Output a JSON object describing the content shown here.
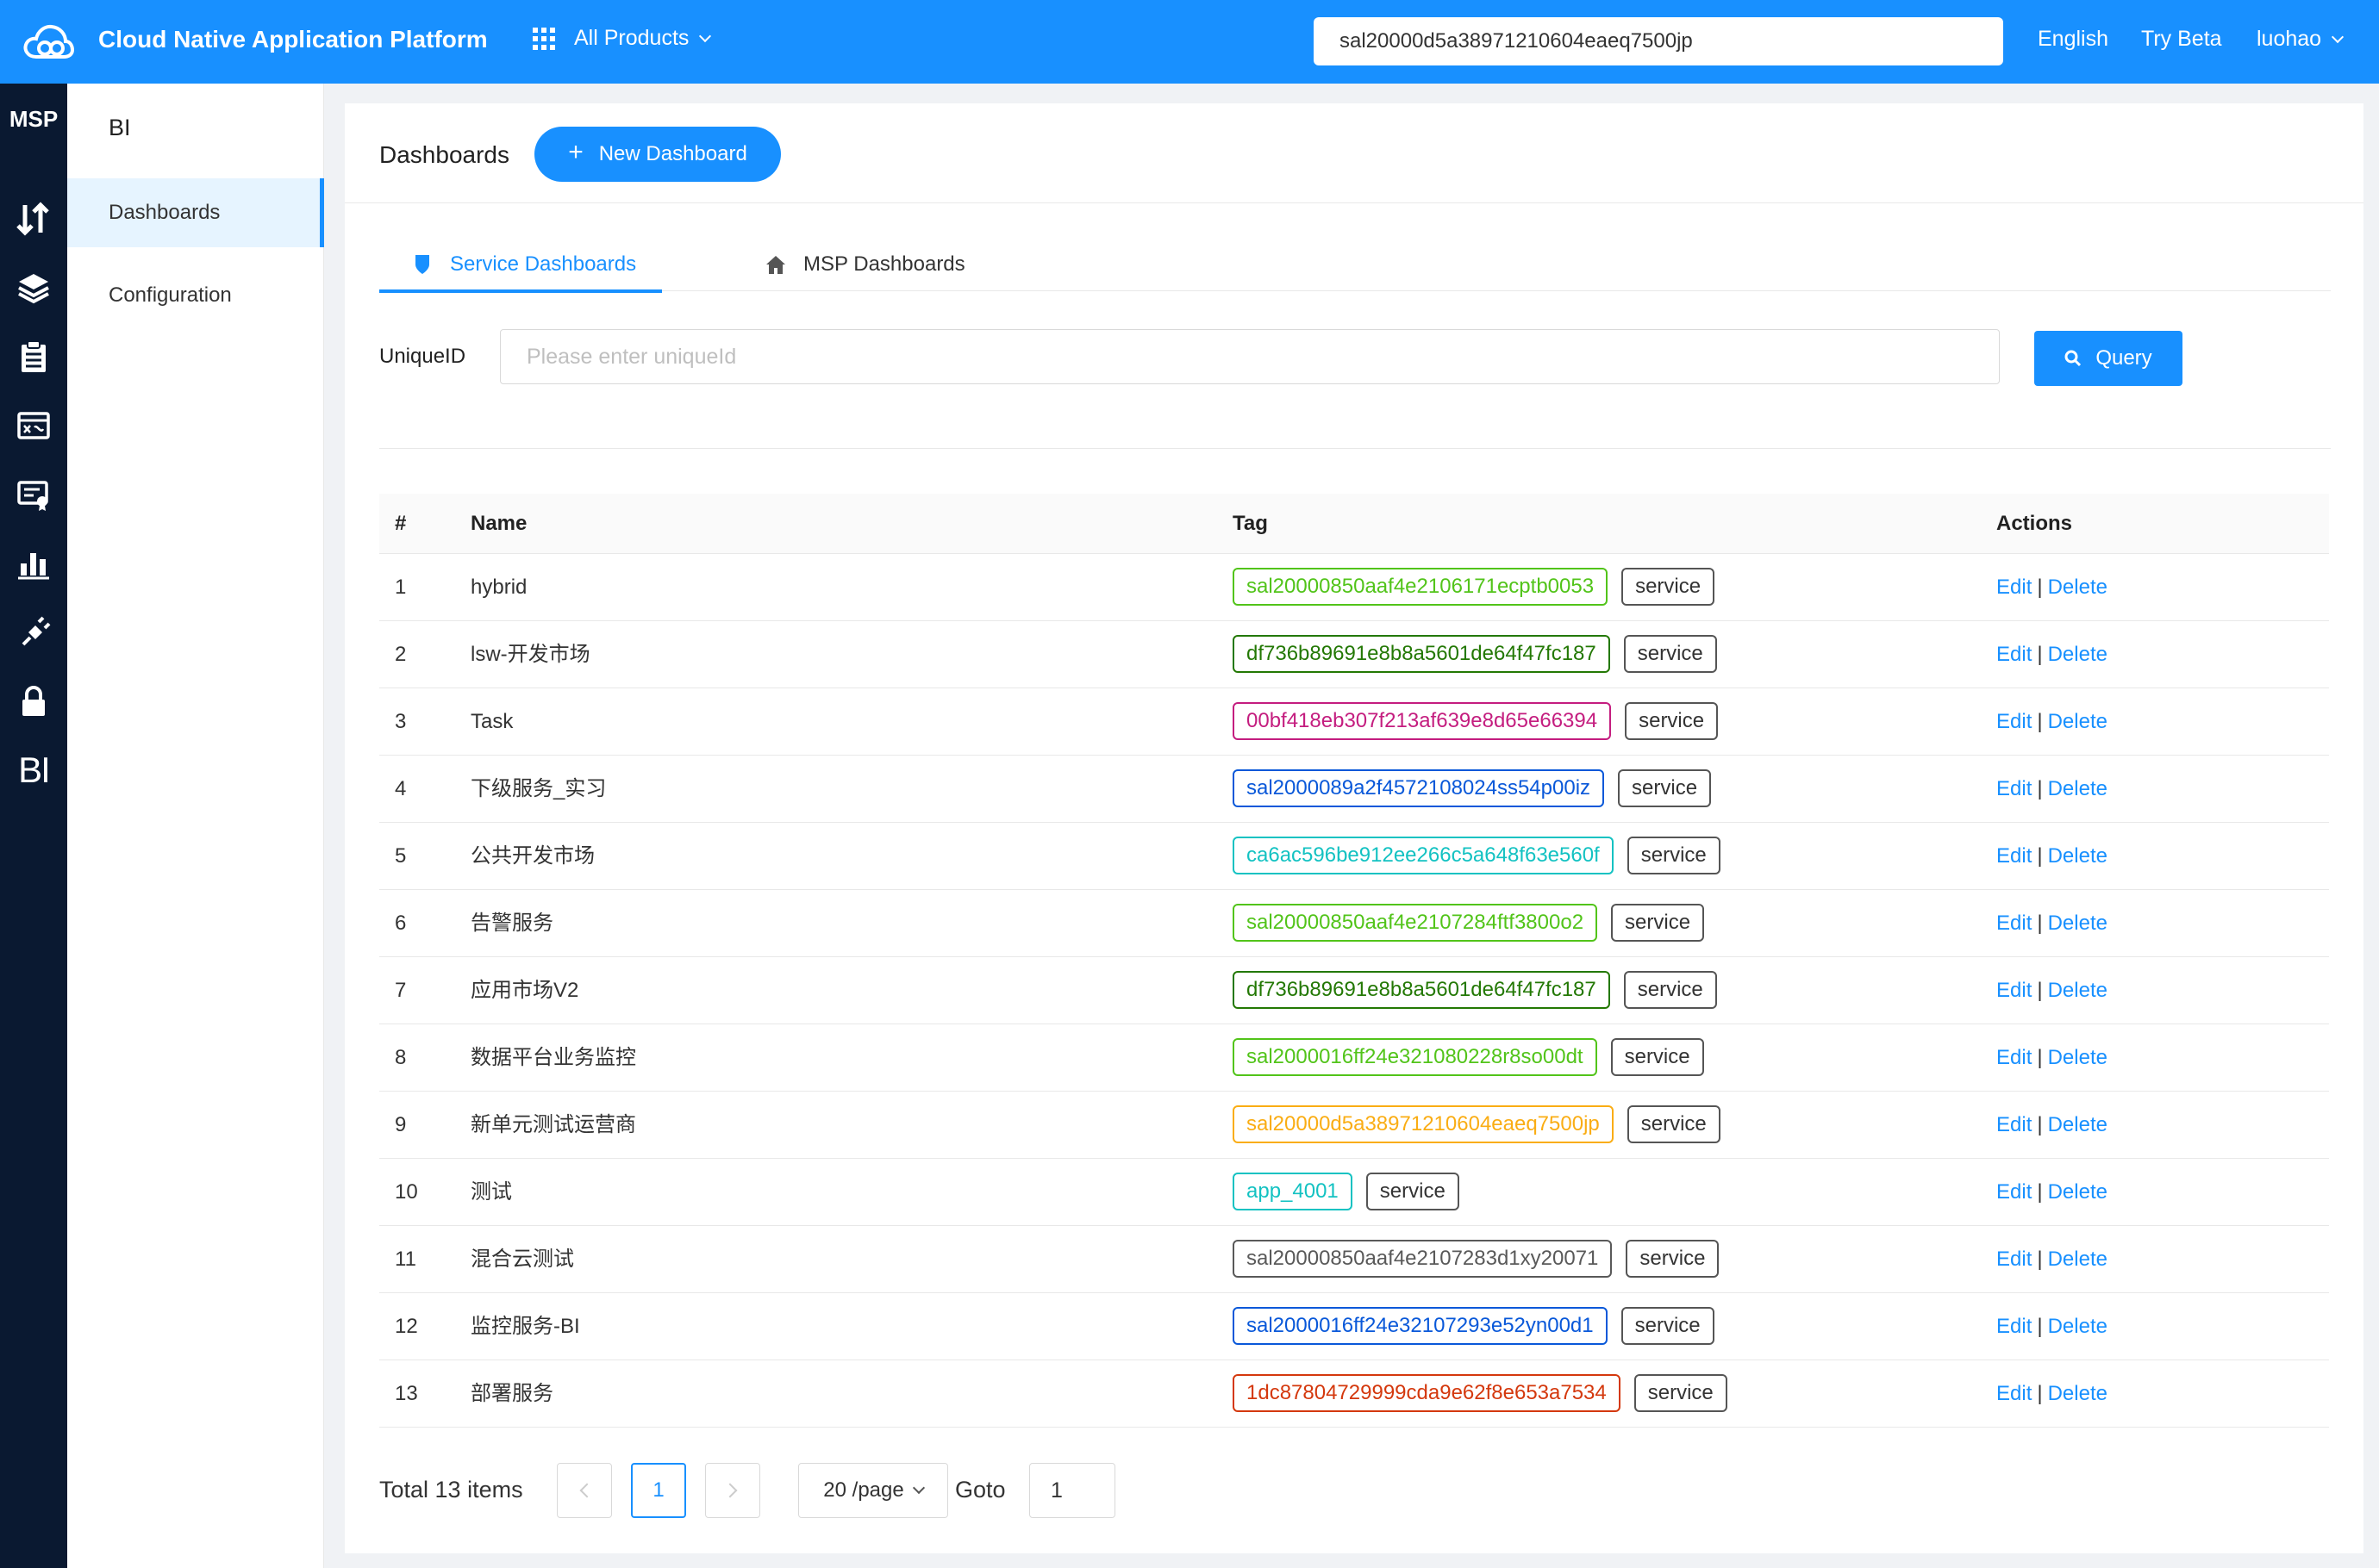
{
  "header": {
    "app_title": "Cloud Native Application Platform",
    "products_label": "All Products",
    "search_value": "sal20000d5a38971210604eaeq7500jp",
    "language": "English",
    "try_beta": "Try Beta",
    "user": "luohao",
    "brand_color": "#1890ff"
  },
  "rail": {
    "brand": "MSP",
    "icons": [
      "transfer-icon",
      "layers-icon",
      "clipboard-icon",
      "monitor-icon",
      "certificate-icon",
      "bar-chart-icon",
      "plug-icon",
      "lock-icon",
      "bi-icon"
    ],
    "bi_label": "BI"
  },
  "subnav": {
    "title": "BI",
    "items": [
      {
        "label": "Dashboards",
        "active": true
      },
      {
        "label": "Configuration",
        "active": false
      }
    ]
  },
  "page": {
    "title": "Dashboards",
    "new_button": "New Dashboard",
    "tabs": [
      {
        "label": "Service Dashboards",
        "icon": "shield-icon",
        "active": true
      },
      {
        "label": "MSP Dashboards",
        "icon": "home-icon",
        "active": false
      }
    ],
    "filter": {
      "label": "UniqueID",
      "placeholder": "Please enter uniqueId",
      "value": "",
      "query_button": "Query"
    }
  },
  "table": {
    "columns": [
      "#",
      "Name",
      "Tag",
      "Actions"
    ],
    "edit_label": "Edit",
    "delete_label": "Delete",
    "separator": "|",
    "rows": [
      {
        "idx": "1",
        "name": "hybrid",
        "tag": "sal20000850aaf4e2106171ecptb0053",
        "tag_color": "#52c41a",
        "type": "service"
      },
      {
        "idx": "2",
        "name": "lsw-开发市场",
        "tag": "df736b89691e8b8a5601de64f47fc187",
        "tag_color": "#237804",
        "type": "service"
      },
      {
        "idx": "3",
        "name": "Task",
        "tag": "00bf418eb307f213af639e8d65e66394",
        "tag_color": "#c41d7f",
        "type": "service"
      },
      {
        "idx": "4",
        "name": "下级服务_实习",
        "tag": "sal2000089a2f4572108024ss54p00iz",
        "tag_color": "#0958d9",
        "type": "service"
      },
      {
        "idx": "5",
        "name": "公共开发市场",
        "tag": "ca6ac596be912ee266c5a648f63e560f",
        "tag_color": "#13c2c2",
        "type": "service"
      },
      {
        "idx": "6",
        "name": "告警服务",
        "tag": "sal20000850aaf4e2107284ftf3800o2",
        "tag_color": "#52c41a",
        "type": "service"
      },
      {
        "idx": "7",
        "name": "应用市场V2",
        "tag": "df736b89691e8b8a5601de64f47fc187",
        "tag_color": "#237804",
        "type": "service"
      },
      {
        "idx": "8",
        "name": "数据平台业务监控",
        "tag": "sal2000016ff24e321080228r8so00dt",
        "tag_color": "#52c41a",
        "type": "service"
      },
      {
        "idx": "9",
        "name": "新单元测试运营商",
        "tag": "sal20000d5a38971210604eaeq7500jp",
        "tag_color": "#faad14",
        "type": "service"
      },
      {
        "idx": "10",
        "name": "测试",
        "tag": "app_4001",
        "tag_color": "#13c2c2",
        "type": "service"
      },
      {
        "idx": "11",
        "name": "混合云测试",
        "tag": "sal20000850aaf4e2107283d1xy20071",
        "tag_color": "#595959",
        "type": "service"
      },
      {
        "idx": "12",
        "name": "监控服务-BI",
        "tag": "sal2000016ff24e32107293e52yn00d1",
        "tag_color": "#0958d9",
        "type": "service"
      },
      {
        "idx": "13",
        "name": "部署服务",
        "tag": "1dc87804729999cda9e62f8e653a7534",
        "tag_color": "#d4380d",
        "type": "service"
      }
    ]
  },
  "pagination": {
    "total_text": "Total 13 items",
    "current_page": "1",
    "page_size": "20 /page",
    "goto_label": "Goto",
    "goto_value": "1"
  }
}
